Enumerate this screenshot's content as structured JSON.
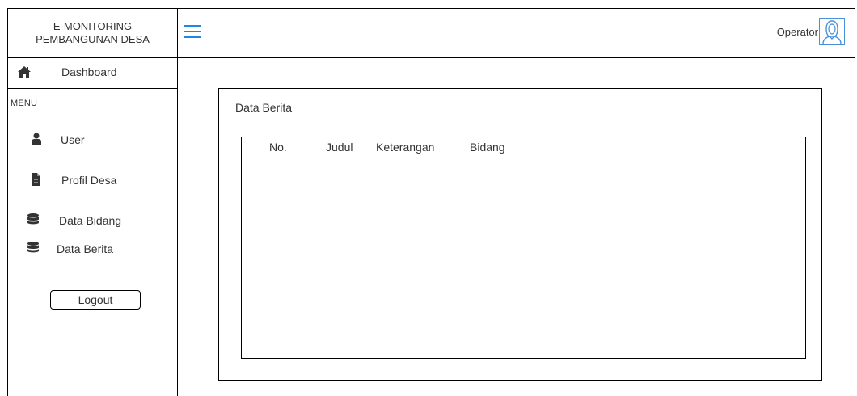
{
  "brand": {
    "line1": "E-MONITORING",
    "line2": "PEMBANGUNAN DESA"
  },
  "header": {
    "menu_icon": "hamburger-icon",
    "user_label": "Operator",
    "avatar_icon": "user-avatar-icon"
  },
  "sidebar": {
    "dashboard": {
      "label": "Dashboard",
      "icon": "home-icon"
    },
    "menu_heading": "MENU",
    "items": [
      {
        "label": "User",
        "icon": "user-icon"
      },
      {
        "label": "Profil Desa",
        "icon": "document-icon"
      },
      {
        "label": "Data Bidang",
        "icon": "database-icon"
      },
      {
        "label": "Data Berita",
        "icon": "database-icon"
      }
    ],
    "logout_label": "Logout"
  },
  "main": {
    "title": "Data Berita",
    "table": {
      "columns": [
        "No.",
        "Judul",
        "Keterangan",
        "Bidang"
      ],
      "rows": []
    }
  },
  "colors": {
    "accent": "#1E88E5",
    "avatar_border": "#4A90D9",
    "icon": "#333333"
  }
}
